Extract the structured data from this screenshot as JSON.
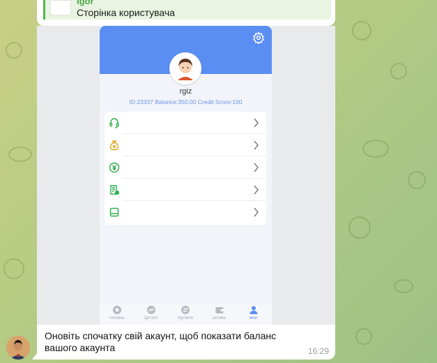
{
  "reply": {
    "author": "Igor",
    "text": "Сторінка користувача"
  },
  "app": {
    "username": "rgiz",
    "stats": "ID:23337  Balance:350.00  Credit Score:100",
    "menu_icons": [
      "headset-icon",
      "moneybag-icon",
      "yuan-icon",
      "receipt-icon",
      "wallet-icon"
    ],
    "tabs": [
      {
        "label": "головна",
        "icon": "home-icon",
        "active": false
      },
      {
        "label": "Цитати",
        "icon": "chart-icon",
        "active": false
      },
      {
        "label": "торгівля",
        "icon": "trade-icon",
        "active": false
      },
      {
        "label": "активи",
        "icon": "assets-icon",
        "active": false
      },
      {
        "label": "мои",
        "icon": "profile-icon",
        "active": true
      }
    ],
    "accent": "#5b8ef2"
  },
  "message": {
    "text": "Оновіть спочатку свій акаунт, щоб показати баланс вашого акаунта",
    "time": "16:29"
  },
  "colors": {
    "reply_accent": "#52b749",
    "background_start": "#c9cf86",
    "background_end": "#9dc184"
  }
}
